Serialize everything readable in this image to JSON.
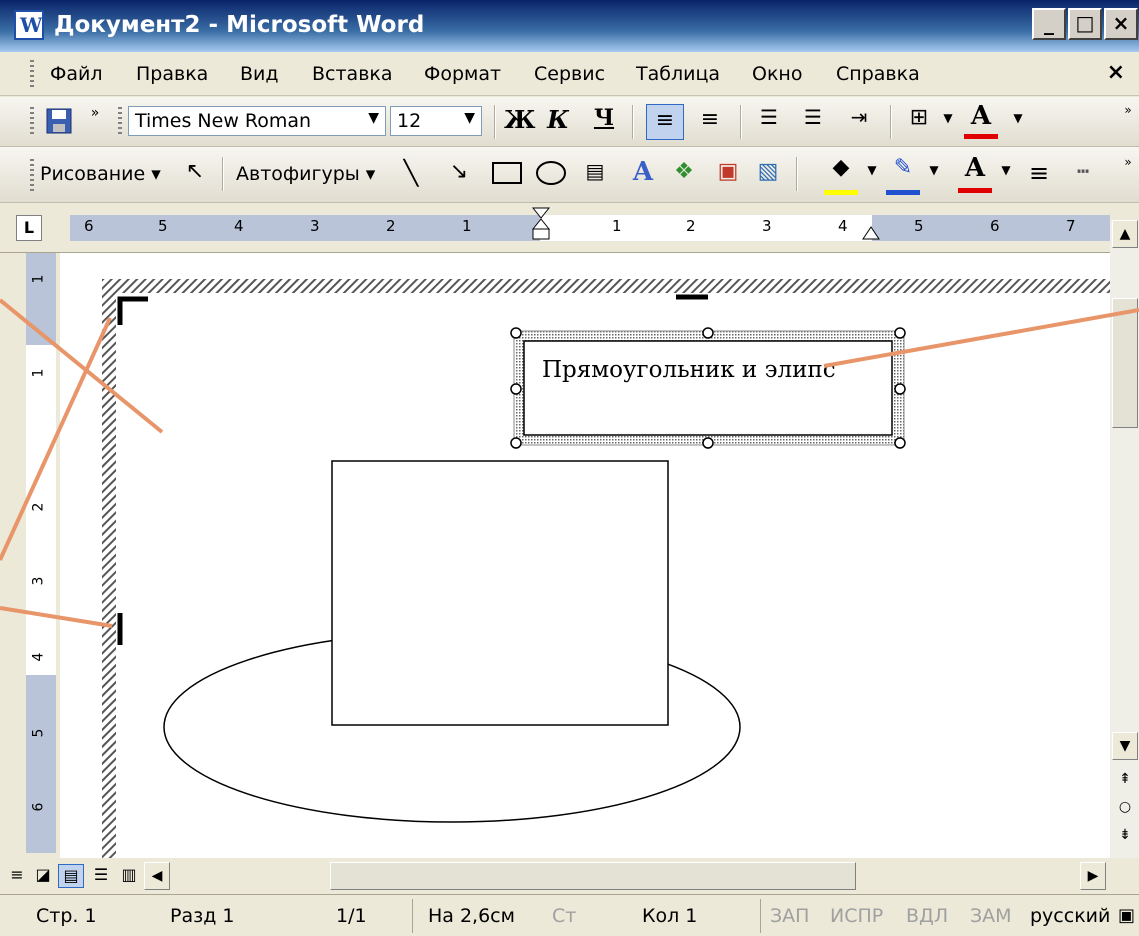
{
  "window": {
    "title": "Документ2 - Microsoft Word",
    "min_glyph": "_",
    "max_glyph": "□",
    "close_glyph": "×"
  },
  "menu": {
    "items": [
      "Файл",
      "Правка",
      "Вид",
      "Вставка",
      "Формат",
      "Сервис",
      "Таблица",
      "Окно",
      "Справка"
    ],
    "close_glyph": "×"
  },
  "format_toolbar": {
    "font_name": "Times New Roman",
    "font_size": "12",
    "bold": "Ж",
    "italic": "К",
    "underline": "Ч",
    "font_color_glyph": "A"
  },
  "draw_toolbar": {
    "drawing_label": "Рисование ▾",
    "autoshapes_label": "Автофигуры ▾",
    "font_color_glyph": "A"
  },
  "ruler": {
    "left_nums": [
      "6",
      "5",
      "4",
      "3",
      "2",
      "1"
    ],
    "right_nums": [
      "1",
      "2",
      "3",
      "4",
      "5",
      "6",
      "7"
    ],
    "vertical_nums": [
      "1",
      "1",
      "2",
      "3",
      "4",
      "5",
      "6"
    ],
    "tab_selector": "L"
  },
  "document": {
    "textbox_text": "Прямоугольник и элипс"
  },
  "statusbar": {
    "page": "Стр. 1",
    "section": "Разд 1",
    "pages": "1/1",
    "at": "На 2,6см",
    "line": "Ст",
    "col": "Кол 1",
    "rec": "ЗАП",
    "trk": "ИСПР",
    "ext": "ВДЛ",
    "ovr": "ЗАМ",
    "lang": "русский"
  },
  "colors": {
    "annotation_line": "#e8956a",
    "title_bar": "#0a246a",
    "selection": "#316ac5"
  }
}
